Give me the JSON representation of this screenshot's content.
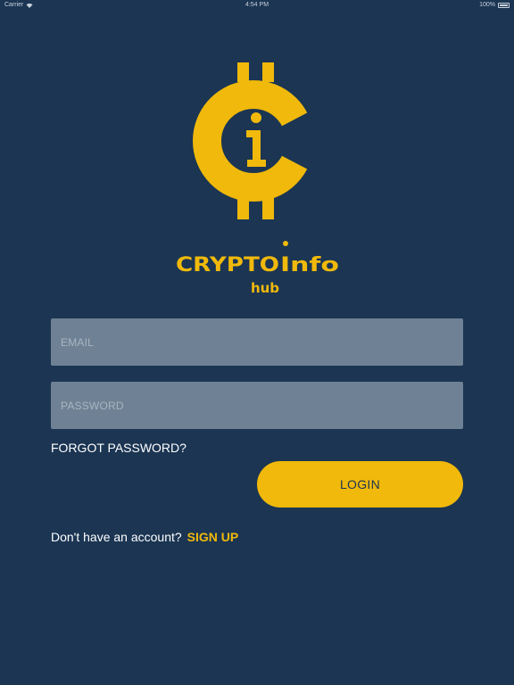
{
  "status_bar": {
    "carrier": "Carrier",
    "time": "4:54 PM",
    "battery": "100%"
  },
  "brand": {
    "name_part1": "CRYPTO",
    "name_part2": "Info",
    "subtitle": "hub",
    "accent_color": "#f0b90b",
    "background_color": "#1b3553"
  },
  "form": {
    "email_placeholder": "EMAIL",
    "password_placeholder": "PASSWORD",
    "forgot_password_label": "FORGOT PASSWORD?",
    "login_label": "LOGIN",
    "signup_prompt": "Don't have an account?",
    "signup_label": "SIGN UP"
  }
}
